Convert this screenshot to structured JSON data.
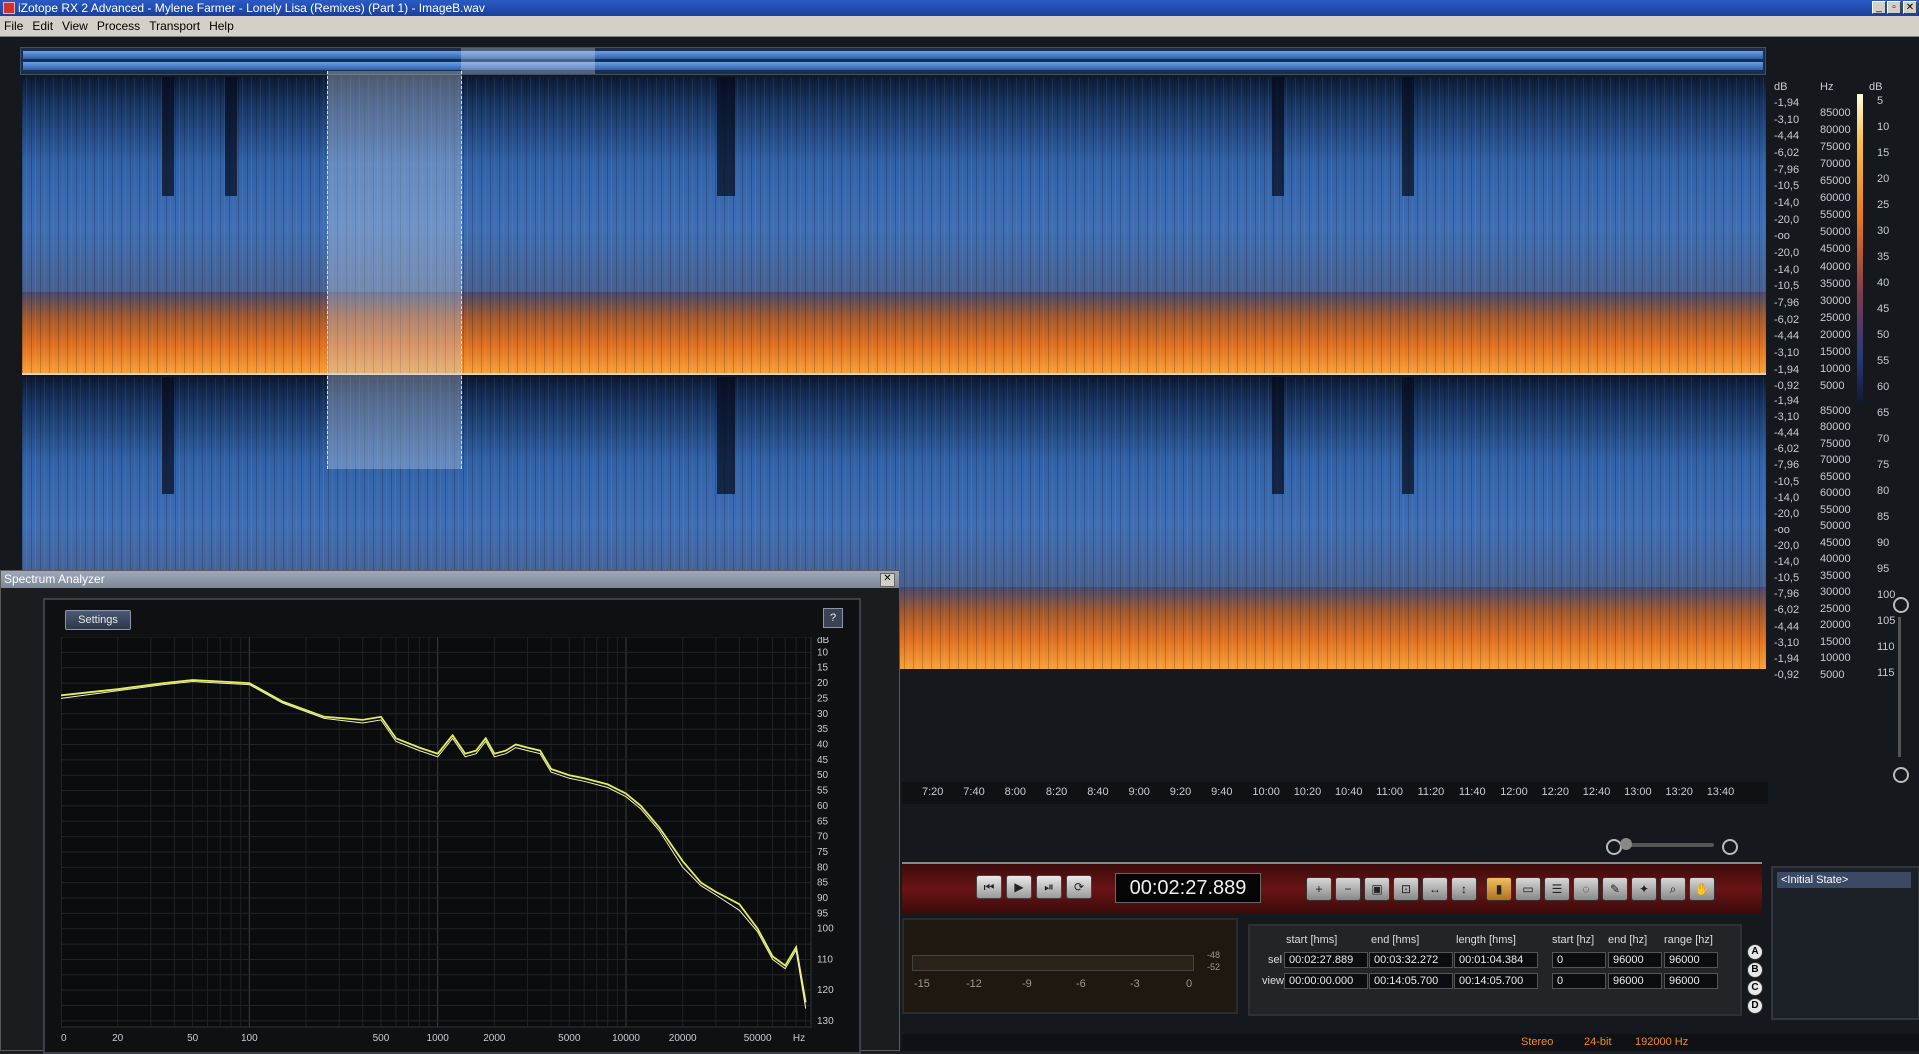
{
  "window": {
    "title": "iZotope RX 2 Advanced - Mylene Farmer - Lonely Lisa (Remixes) (Part 1) - ImageB.wav",
    "buttons": {
      "minimize": "_",
      "restore": "▫",
      "close": "✕"
    }
  },
  "menu": [
    "File",
    "Edit",
    "View",
    "Process",
    "Transport",
    "Help"
  ],
  "spectrogram": {
    "db_scale": [
      "-1,94",
      "-3,10",
      "-4,44",
      "-6,02",
      "-7,96",
      "-10,5",
      "-14,0",
      "-20,0",
      "-oo",
      "-20,0",
      "-14,0",
      "-10,5",
      "-7,96",
      "-6,02",
      "-4,44",
      "-3,10",
      "-1,94",
      "-0,92"
    ],
    "db_label": "dB",
    "hz_label": "Hz",
    "hz_scale": [
      "85000",
      "80000",
      "75000",
      "70000",
      "65000",
      "60000",
      "55000",
      "50000",
      "45000",
      "40000",
      "35000",
      "30000",
      "25000",
      "20000",
      "15000",
      "10000",
      "5000"
    ],
    "color_scale_label": "dB",
    "color_scale": [
      "5",
      "10",
      "15",
      "20",
      "25",
      "30",
      "35",
      "40",
      "45",
      "50",
      "55",
      "60",
      "65",
      "70",
      "75",
      "80",
      "85",
      "90",
      "95",
      "100",
      "105",
      "110",
      "115"
    ],
    "colors": {
      "low": "#0c1a34",
      "mid": "#3f6eb4",
      "hot": "#f8a23a"
    }
  },
  "timeline": [
    "7:20",
    "7:40",
    "8:00",
    "8:20",
    "8:40",
    "9:00",
    "9:20",
    "9:40",
    "10:00",
    "10:20",
    "10:40",
    "11:00",
    "11:20",
    "11:40",
    "12:00",
    "12:20",
    "12:40",
    "13:00",
    "13:20",
    "13:40"
  ],
  "transport": {
    "timecode": "00:02:27.889",
    "buttons": [
      "skip-back-icon",
      "play-icon",
      "play-selection-icon",
      "loop-icon"
    ],
    "tools": [
      "zoom-in-icon",
      "zoom-out-icon",
      "zoom-selection-icon",
      "zoom-fit-icon",
      "zoom-time-icon",
      "zoom-freq-icon",
      "time-select-icon",
      "rect-select-icon",
      "freq-select-icon",
      "lasso-icon",
      "brush-icon",
      "wand-icon",
      "magnify-icon",
      "hand-icon"
    ]
  },
  "meters": {
    "scale": [
      "-15",
      "-12",
      "-9",
      "-6",
      "-3",
      "0"
    ],
    "peaks": [
      "-48",
      "-52"
    ]
  },
  "selection": {
    "headers": [
      "start [hms]",
      "end [hms]",
      "length [hms]",
      "start [hz]",
      "end [hz]",
      "range [hz]"
    ],
    "rows": [
      {
        "label": "sel",
        "values": [
          "00:02:27.889",
          "00:03:32.272",
          "00:01:04.384",
          "0",
          "96000",
          "96000"
        ]
      },
      {
        "label": "view",
        "values": [
          "00:00:00.000",
          "00:14:05.700",
          "00:14:05.700",
          "0",
          "96000",
          "96000"
        ]
      }
    ],
    "snapshots": [
      "A",
      "B",
      "C",
      "D"
    ]
  },
  "history": {
    "items": [
      "<Initial State>"
    ]
  },
  "status": {
    "channels": "Stereo",
    "bitdepth": "24-bit",
    "samplerate": "192000 Hz"
  },
  "spectrum_analyzer": {
    "title": "Spectrum Analyzer",
    "close": "✕",
    "settings_label": "Settings",
    "help_label": "?"
  },
  "chart_data": {
    "type": "line",
    "title": "",
    "xlabel": "Hz",
    "ylabel": "dB",
    "x_scale": "log",
    "xlim": [
      10,
      96000
    ],
    "ylim": [
      -132,
      -5
    ],
    "x_ticks": [
      "10",
      "20",
      "50",
      "100",
      "500",
      "1000",
      "2000",
      "5000",
      "10000",
      "20000",
      "50000",
      "Hz"
    ],
    "y_ticks": [
      "dB",
      "10",
      "15",
      "20",
      "25",
      "30",
      "35",
      "40",
      "45",
      "50",
      "55",
      "60",
      "65",
      "70",
      "75",
      "80",
      "85",
      "90",
      "95",
      "100",
      "110",
      "120",
      "130"
    ],
    "grid": true,
    "legend": "none",
    "series": [
      {
        "color": "#e6ef5a",
        "x": [
          10,
          20,
          35,
          50,
          70,
          100,
          150,
          250,
          400,
          500,
          600,
          800,
          1000,
          1200,
          1400,
          1600,
          1800,
          2000,
          2300,
          2600,
          3000,
          3500,
          4000,
          5000,
          6000,
          8000,
          10000,
          12000,
          15000,
          20000,
          25000,
          30000,
          40000,
          50000,
          60000,
          70000,
          80000,
          90000
        ],
        "y": [
          -24,
          -22,
          -20,
          -19,
          -19.5,
          -20,
          -26,
          -31,
          -32,
          -31,
          -38,
          -41,
          -43,
          -37,
          -43,
          -42,
          -38,
          -43,
          -42,
          -40,
          -41,
          -42,
          -48,
          -50,
          -51,
          -53,
          -56,
          -60,
          -67,
          -78,
          -85,
          -88,
          -92,
          -100,
          -109,
          -112,
          -106,
          -124
        ]
      },
      {
        "color": "#f2f2c8",
        "x": [
          10,
          20,
          35,
          50,
          70,
          100,
          150,
          250,
          400,
          500,
          600,
          800,
          1000,
          1200,
          1400,
          1600,
          1800,
          2000,
          2300,
          2600,
          3000,
          3500,
          4000,
          5000,
          6000,
          8000,
          10000,
          12000,
          15000,
          20000,
          25000,
          30000,
          40000,
          50000,
          60000,
          70000,
          80000,
          90000
        ],
        "y": [
          -25,
          -22.5,
          -20.5,
          -19.5,
          -20,
          -20.5,
          -26.5,
          -31.5,
          -33,
          -32,
          -39,
          -42,
          -44,
          -38,
          -44,
          -43,
          -39,
          -44,
          -43,
          -41,
          -42,
          -43,
          -49,
          -51,
          -52,
          -54,
          -57,
          -61,
          -68,
          -80,
          -86,
          -89,
          -94,
          -101,
          -110,
          -113,
          -107,
          -126
        ]
      }
    ]
  }
}
